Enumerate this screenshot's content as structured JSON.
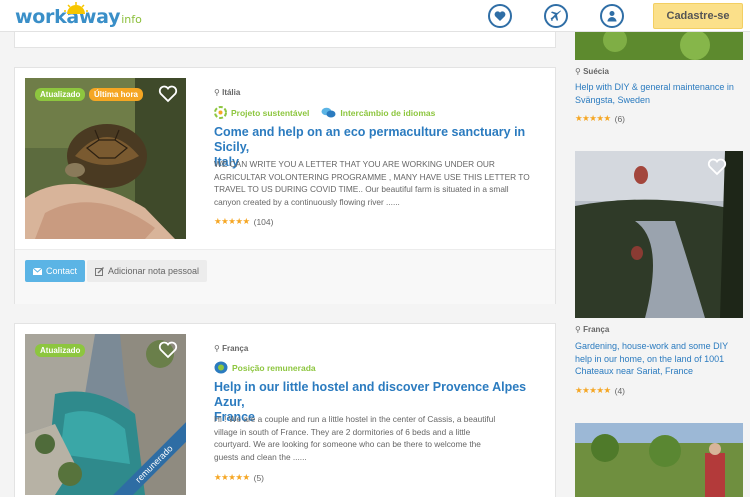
{
  "header": {
    "logo_main": "workaway",
    "logo_sub": "info",
    "icons": [
      "heart-icon",
      "plane-icon",
      "user-icon"
    ],
    "signup_label": "Cadastre-se"
  },
  "colors": {
    "brand_blue": "#2b7bbf",
    "accent_green": "#8dc63f",
    "accent_orange": "#f5a623",
    "signup_yellow": "#fbe08a",
    "contact_blue": "#5bb4e5"
  },
  "listings": [
    {
      "badges": [
        "Atualizado",
        "Última hora"
      ],
      "country": "Itália",
      "tags": [
        "Projeto sustentável",
        "Intercâmbio de idiomas"
      ],
      "title_line1": "Come and help on an eco permaculture sanctuary in Sicily,",
      "title_line2": "Italy",
      "desc_lines": [
        "WE CAN WRITE YOU A LETTER THAT YOU ARE WORKING UNDER OUR",
        "AGRICULTAR VOLONTERING PROGRAMME , MANY HAVE USE THIS LETTER TO",
        "TRAVEL TO US DURING COVID TIME.. Our beautiful farm is situated in a small",
        "canyon created by a continuously flowing river ......"
      ],
      "stars": "★★★★★",
      "reviews": "(104)",
      "contact_label": "Contact",
      "note_label": "Adicionar nota pessoal"
    },
    {
      "badges": [
        "Atualizado"
      ],
      "country": "França",
      "tags": [
        "Posição remunerada"
      ],
      "title_line1": "Help in our little hostel and discover Provence Alpes Azur,",
      "title_line2": "France",
      "desc_lines": [
        "Hi ! We are a couple and run a little hostel in the center of Cassis, a beautiful",
        "village in south of France. They are 2 dormitories of 6 beds and a little",
        "courtyard. We are looking for someone who can be there to welcome the",
        "guests and clean the ......"
      ],
      "stars": "★★★★★",
      "reviews": "(5)",
      "ribbon": "remunerado"
    }
  ],
  "sidebar": [
    {
      "country": "Suécia",
      "title_lines": [
        "Help with DIY & general maintenance in",
        "Svängsta, Sweden"
      ],
      "stars": "★★★★★",
      "reviews": "(6)"
    },
    {
      "country": "França",
      "title_lines": [
        "Gardening, house-work and some DIY",
        "help in our home, on the land of 1001",
        "Chateaux near Sariat, France"
      ],
      "stars": "★★★★★",
      "reviews": "(4)"
    }
  ]
}
